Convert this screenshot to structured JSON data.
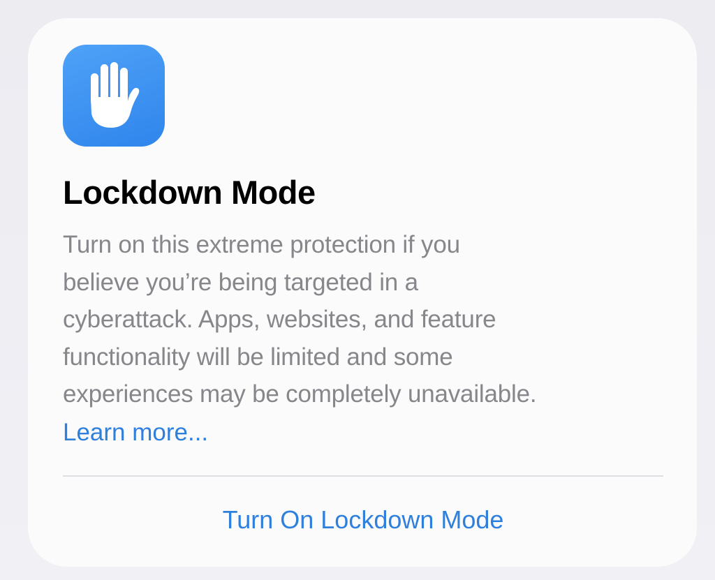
{
  "card": {
    "icon": "hand-raised-icon",
    "accent_color": "#2f85ec",
    "title": "Lockdown Mode",
    "description_lines": [
      "Turn on this extreme protection if you",
      "believe you’re being targeted in a",
      "cyberattack. Apps, websites, and feature",
      "functionality will be limited and some",
      "experiences may be completely unavailable."
    ],
    "learn_more_label": "Learn more...",
    "action_label": "Turn On Lockdown Mode"
  }
}
